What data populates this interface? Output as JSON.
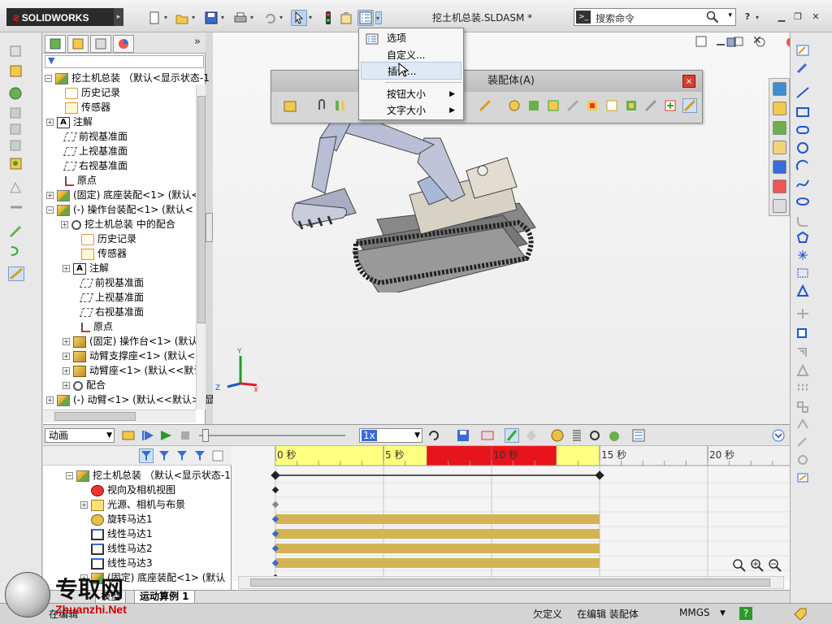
{
  "app": {
    "name": "SOLIDWORKS",
    "doc_title": "挖土机总装.SLDASM *"
  },
  "search": {
    "placeholder": "搜索命令"
  },
  "menu": {
    "items": [
      {
        "label": "选项",
        "sub": false
      },
      {
        "label": "自定义...",
        "sub": false
      },
      {
        "label": "插件...",
        "sub": false,
        "highlighted": true
      },
      {
        "label": "按钮大小",
        "sub": true
      },
      {
        "label": "文字大小",
        "sub": true
      }
    ]
  },
  "float_toolbar": {
    "title": "装配体(A)",
    "close": "×"
  },
  "tree": {
    "expand_glyph": "»",
    "rows": [
      {
        "plus": "−",
        "icon": "asm",
        "label": "挖土机总装 （默认<显示状态-1"
      },
      {
        "plus": "",
        "icon": "hist",
        "label": "历史记录"
      },
      {
        "plus": "",
        "icon": "sens",
        "label": "传感器"
      },
      {
        "plus": "+",
        "icon": "annot",
        "label": "注解"
      },
      {
        "plus": "",
        "icon": "plane",
        "label": "前视基准面"
      },
      {
        "plus": "",
        "icon": "plane",
        "label": "上视基准面"
      },
      {
        "plus": "",
        "icon": "plane",
        "label": "右视基准面"
      },
      {
        "plus": "",
        "icon": "origin",
        "label": "原点"
      },
      {
        "plus": "+",
        "icon": "asm",
        "label": "(固定) 底座装配<1> (默认<"
      },
      {
        "plus": "−",
        "icon": "asm",
        "label": "(-) 操作台装配<1> (默认<"
      },
      {
        "plus": "+",
        "icon": "mate",
        "label": "挖土机总装 中的配合"
      },
      {
        "plus": "",
        "icon": "hist",
        "label": "历史记录"
      },
      {
        "plus": "",
        "icon": "sens",
        "label": "传感器"
      },
      {
        "plus": "+",
        "icon": "annot",
        "label": "注解"
      },
      {
        "plus": "",
        "icon": "plane",
        "label": "前视基准面"
      },
      {
        "plus": "",
        "icon": "plane",
        "label": "上视基准面"
      },
      {
        "plus": "",
        "icon": "plane",
        "label": "右视基准面"
      },
      {
        "plus": "",
        "icon": "origin",
        "label": "原点"
      },
      {
        "plus": "+",
        "icon": "part",
        "label": "(固定) 操作台<1> (默认"
      },
      {
        "plus": "+",
        "icon": "part",
        "label": "动臂支撑座<1> (默认<"
      },
      {
        "plus": "+",
        "icon": "part",
        "label": "动臂座<1> (默认<<默认"
      },
      {
        "plus": "+",
        "icon": "mate",
        "label": "配合"
      },
      {
        "plus": "+",
        "icon": "asm",
        "label": "(-) 动臂<1> (默认<<默认>_显"
      }
    ]
  },
  "motion": {
    "study_type": "动画",
    "speed": "1x",
    "ruler": [
      {
        "label": "0 秒",
        "sec": 0
      },
      {
        "label": "5 秒",
        "sec": 5
      },
      {
        "label": "10 秒",
        "sec": 10
      },
      {
        "label": "15 秒",
        "sec": 15
      },
      {
        "label": "20 秒",
        "sec": 20
      }
    ],
    "duration_sec": 15,
    "red_range_sec": [
      7,
      13
    ],
    "tree": [
      {
        "plus": "−",
        "icon": "asm",
        "label": "挖土机总装 （默认<显示状态-1>"
      },
      {
        "plus": "",
        "icon": "view",
        "label": "视向及相机视图"
      },
      {
        "plus": "+",
        "icon": "light",
        "label": "光源、相机与布景"
      },
      {
        "plus": "",
        "icon": "motor",
        "label": "旋转马达1"
      },
      {
        "plus": "",
        "icon": "lin",
        "label": "线性马达1"
      },
      {
        "plus": "",
        "icon": "lin",
        "label": "线性马达2"
      },
      {
        "plus": "",
        "icon": "lin",
        "label": "线性马达3"
      },
      {
        "plus": "+",
        "icon": "asm",
        "label": "(固定) 底座装配<1> (默认"
      }
    ],
    "bars": [
      {
        "row": 3,
        "from": 0,
        "to": 15
      },
      {
        "row": 4,
        "from": 0,
        "to": 15
      },
      {
        "row": 5,
        "from": 0,
        "to": 15
      },
      {
        "row": 6,
        "from": 0,
        "to": 15
      }
    ]
  },
  "bottom_tabs": [
    "模型",
    "运动算例 1"
  ],
  "status": {
    "left": "在编辑",
    "state": "欠定义",
    "editing": "在编辑 装配体",
    "units": "MMGS",
    "units_caret": "▼",
    "help": "?"
  },
  "watermark": {
    "cn": "专取网",
    "url": "Zhuanzhi.Net"
  },
  "triad": {
    "x": "X",
    "y": "Y",
    "z": "Z"
  },
  "colors": {
    "timeline_yellow": "#ffff80",
    "timeline_red": "#e8141c",
    "bar": "#d4b452",
    "accent": "#3a6bd4"
  }
}
